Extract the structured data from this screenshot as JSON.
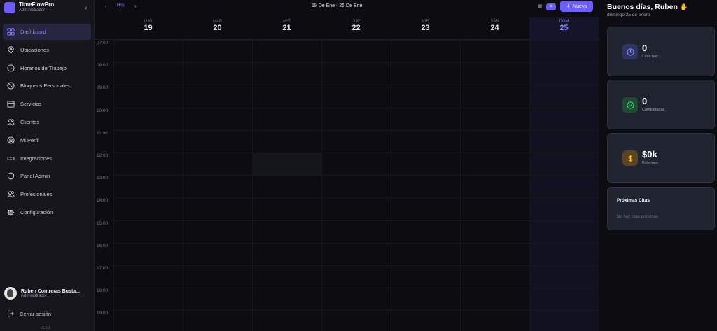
{
  "brand": {
    "name": "TimeFlowPro",
    "role": "Administrador"
  },
  "sidebar": {
    "items": [
      {
        "label": "Dashboard",
        "icon": "dashboard-icon",
        "active": true
      },
      {
        "label": "Ubicaciones",
        "icon": "map-pin-icon"
      },
      {
        "label": "Horarios de Trabajo",
        "icon": "clock-icon"
      },
      {
        "label": "Bloqueos Personales",
        "icon": "ban-icon"
      },
      {
        "label": "Servicios",
        "icon": "calendar-icon"
      },
      {
        "label": "Clientes",
        "icon": "users-icon"
      },
      {
        "label": "Mi Perfil",
        "icon": "user-circle-icon"
      },
      {
        "label": "Integraciones",
        "icon": "link-icon"
      },
      {
        "label": "Panel Admin",
        "icon": "shield-icon"
      },
      {
        "label": "Profesionales",
        "icon": "user-group-icon"
      },
      {
        "label": "Configuración",
        "icon": "gear-icon"
      }
    ],
    "user": {
      "name": "Ruben Contreras Busta...",
      "role": "Administrador"
    },
    "logout_label": "Cerrar sesión",
    "version": "v1.0.1"
  },
  "calendar": {
    "today_label": "Hoy",
    "range": "19 De Ene - 25 De Ene",
    "new_label": "Nueva",
    "days": [
      {
        "name": "LUN",
        "date": "19"
      },
      {
        "name": "MAR",
        "date": "20"
      },
      {
        "name": "MIÉ",
        "date": "21"
      },
      {
        "name": "JUE",
        "date": "22"
      },
      {
        "name": "VIE",
        "date": "23"
      },
      {
        "name": "SÁB",
        "date": "24"
      },
      {
        "name": "DOM",
        "date": "25",
        "today": true
      }
    ],
    "hours": [
      "07:00",
      "08:00",
      "09:00",
      "10:00",
      "11:00",
      "12:00",
      "13:00",
      "14:00",
      "15:00",
      "16:00",
      "17:00",
      "18:00",
      "19:00"
    ]
  },
  "panel": {
    "greeting": "Buenos días, Ruben",
    "date": "domingo 25 de enero",
    "stats": [
      {
        "value": "0",
        "label": "Citas hoy",
        "icon": "clock-icon",
        "bg": "#2f3563",
        "fg": "#8b95f5"
      },
      {
        "value": "0",
        "label": "Completadas",
        "icon": "check-circle-icon",
        "bg": "#1e4a36",
        "fg": "#4ade80"
      },
      {
        "value": "$0k",
        "label": "Este mes",
        "icon": "dollar-icon",
        "bg": "#5a4421",
        "fg": "#fbbf24"
      }
    ],
    "next_title": "Próximas Citas",
    "next_empty": "No hay citas próximas"
  },
  "colors": {
    "accent": "#6d5dfc",
    "sidebar_bg": "#16161c",
    "card_bg": "#1f2430"
  }
}
